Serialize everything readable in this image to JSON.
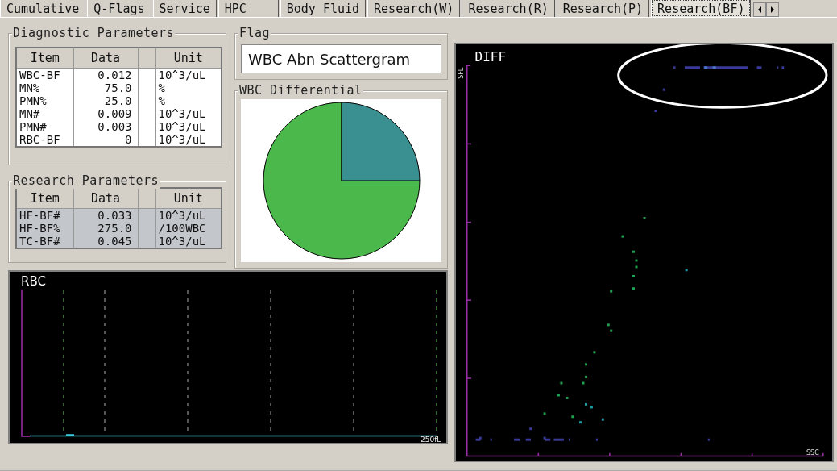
{
  "tabs": [
    {
      "label": "Cumulative",
      "selected": false
    },
    {
      "label": "Q-Flags",
      "selected": false
    },
    {
      "label": "Service",
      "selected": false
    },
    {
      "label": "HPC",
      "selected": false
    },
    {
      "label": "Body Fluid",
      "selected": false
    },
    {
      "label": "Research(W)",
      "selected": false
    },
    {
      "label": "Research(R)",
      "selected": false
    },
    {
      "label": "Research(P)",
      "selected": false
    },
    {
      "label": "Research(BF)",
      "selected": true
    }
  ],
  "diagnostic_parameters": {
    "title": "Diagnostic Parameters",
    "columns": [
      "Item",
      "Data",
      "Unit"
    ],
    "rows": [
      {
        "item": "WBC-BF",
        "data": "0.012",
        "unit": "10^3/uL"
      },
      {
        "item": "MN%",
        "data": "75.0",
        "unit": "%"
      },
      {
        "item": "PMN%",
        "data": "25.0",
        "unit": "%"
      },
      {
        "item": "MN#",
        "data": "0.009",
        "unit": "10^3/uL"
      },
      {
        "item": "PMN#",
        "data": "0.003",
        "unit": "10^3/uL"
      },
      {
        "item": "RBC-BF",
        "data": "0",
        "unit": "10^3/uL"
      }
    ]
  },
  "research_parameters": {
    "title": "Research Parameters",
    "columns": [
      "Item",
      "Data",
      "Unit"
    ],
    "rows": [
      {
        "item": "HF-BF#",
        "data": "0.033",
        "unit": "10^3/uL"
      },
      {
        "item": "HF-BF%",
        "data": "275.0",
        "unit": "/100WBC"
      },
      {
        "item": "TC-BF#",
        "data": "0.045",
        "unit": "10^3/uL"
      }
    ]
  },
  "flag": {
    "title": "Flag",
    "value": "WBC Abn Scattergram"
  },
  "wbc_differential": {
    "title": "WBC Differential"
  },
  "rbc_histogram": {
    "title": "RBC",
    "x_label": "250fL"
  },
  "diff_scattergram": {
    "title": "DIFF",
    "y_label": "SFL",
    "x_label": "SSC"
  }
}
